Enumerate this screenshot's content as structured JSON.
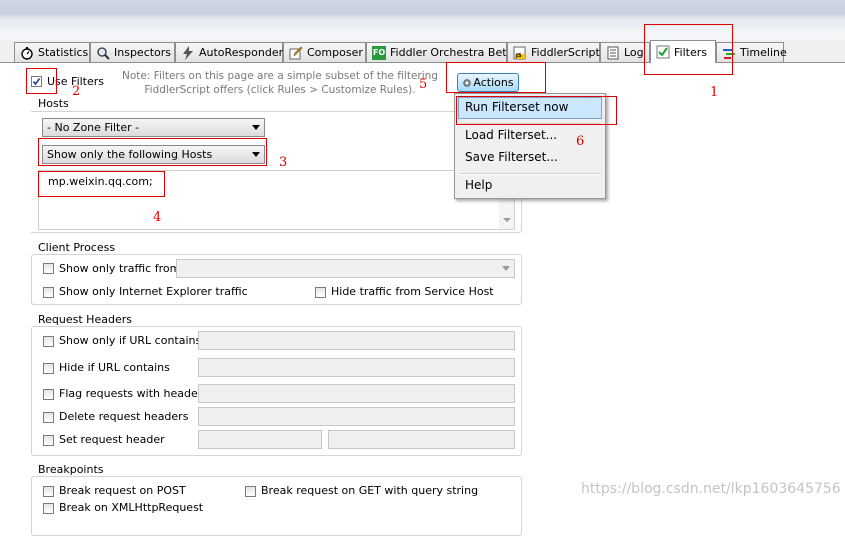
{
  "tabs": [
    {
      "label": "Statistics",
      "icon": "stopwatch-icon"
    },
    {
      "label": "Inspectors",
      "icon": "magnifier-icon"
    },
    {
      "label": "AutoResponder",
      "icon": "lightning-icon"
    },
    {
      "label": "Composer",
      "icon": "pencil-icon"
    },
    {
      "label": "Fiddler Orchestra Beta",
      "icon": "fo-icon",
      "badge": "FO"
    },
    {
      "label": "FiddlerScript",
      "icon": "js-icon",
      "badge": "JS"
    },
    {
      "label": "Log",
      "icon": "document-icon"
    },
    {
      "label": "Filters",
      "icon": "green-check-icon"
    },
    {
      "label": "Timeline",
      "icon": "timeline-icon"
    }
  ],
  "filters": {
    "use_filters_label": "Use Filters",
    "use_filters_checked": true,
    "note": "Note: Filters on this page are a simple subset of the filtering\nFiddlerScript offers (click Rules > Customize Rules).",
    "actions_label": "Actions"
  },
  "hosts": {
    "title": "Hosts",
    "zone_select": "- No Zone Filter -",
    "host_select": "Show only the following Hosts",
    "host_list": "mp.weixin.qq.com;"
  },
  "client_process": {
    "title": "Client Process",
    "traffic_from": "Show only traffic from",
    "ie_traffic": "Show only Internet Explorer traffic",
    "hide_service_host": "Hide traffic from Service Host"
  },
  "request_headers": {
    "title": "Request Headers",
    "show_if_url": "Show only if URL contains",
    "hide_if_url": "Hide if URL contains",
    "flag_headers": "Flag requests with headers",
    "delete_headers": "Delete request headers",
    "set_header": "Set request header"
  },
  "breakpoints": {
    "title": "Breakpoints",
    "break_post": "Break request on POST",
    "break_get": "Break request on GET with query string",
    "break_xml": "Break on XMLHttpRequest"
  },
  "actions_menu": [
    {
      "label": "Run Filterset now",
      "highlighted": true
    },
    {
      "label": "Load Filterset..."
    },
    {
      "label": "Save Filterset..."
    },
    {
      "label": "Help"
    }
  ],
  "annotations": [
    "1",
    "2",
    "3",
    "4",
    "5",
    "6"
  ],
  "watermark": "https://blog.csdn.net/lkp1603645756",
  "colors": {
    "annotation_red": "#e00000",
    "menu_highlight": "#cce8ff",
    "tab_active": "#ffffff"
  }
}
